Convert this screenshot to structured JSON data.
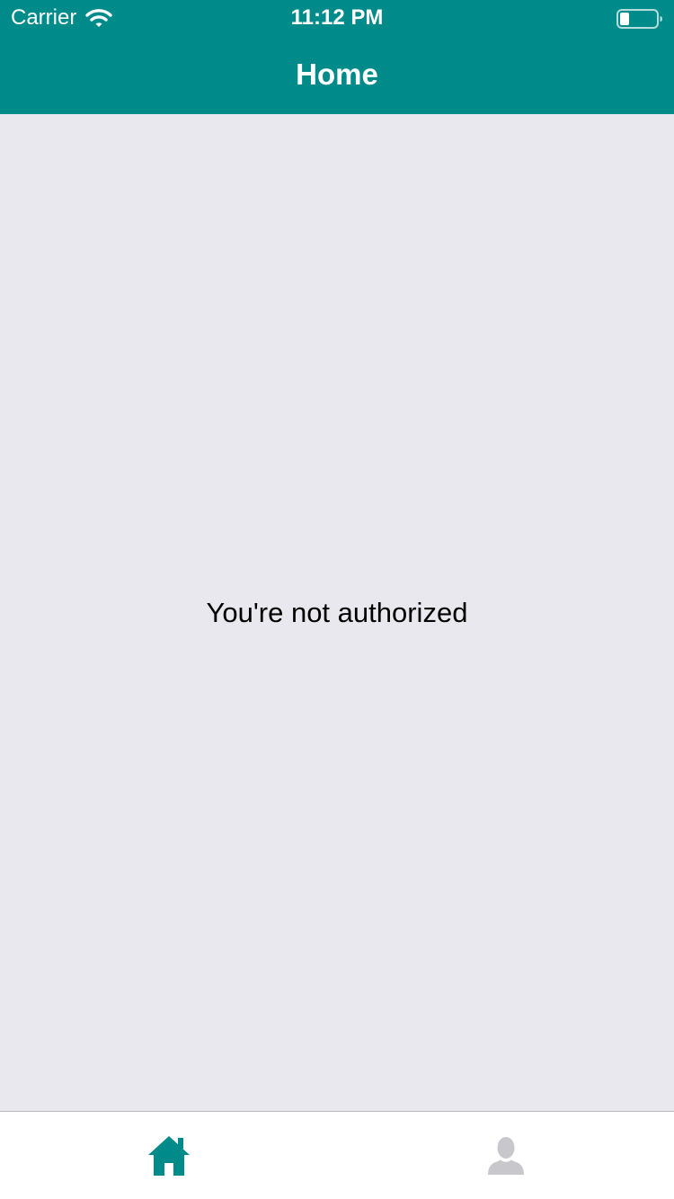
{
  "status_bar": {
    "carrier": "Carrier",
    "time": "11:12 PM"
  },
  "nav": {
    "title": "Home"
  },
  "main": {
    "message": "You're not authorized"
  },
  "tab_bar": {
    "items": [
      {
        "name": "home",
        "icon": "home-icon",
        "selected": true
      },
      {
        "name": "profile",
        "icon": "person-icon",
        "selected": false
      }
    ]
  },
  "colors": {
    "accent": "#008b8b",
    "background": "#e9e8ee",
    "tab_inactive": "#c7c7cc"
  }
}
